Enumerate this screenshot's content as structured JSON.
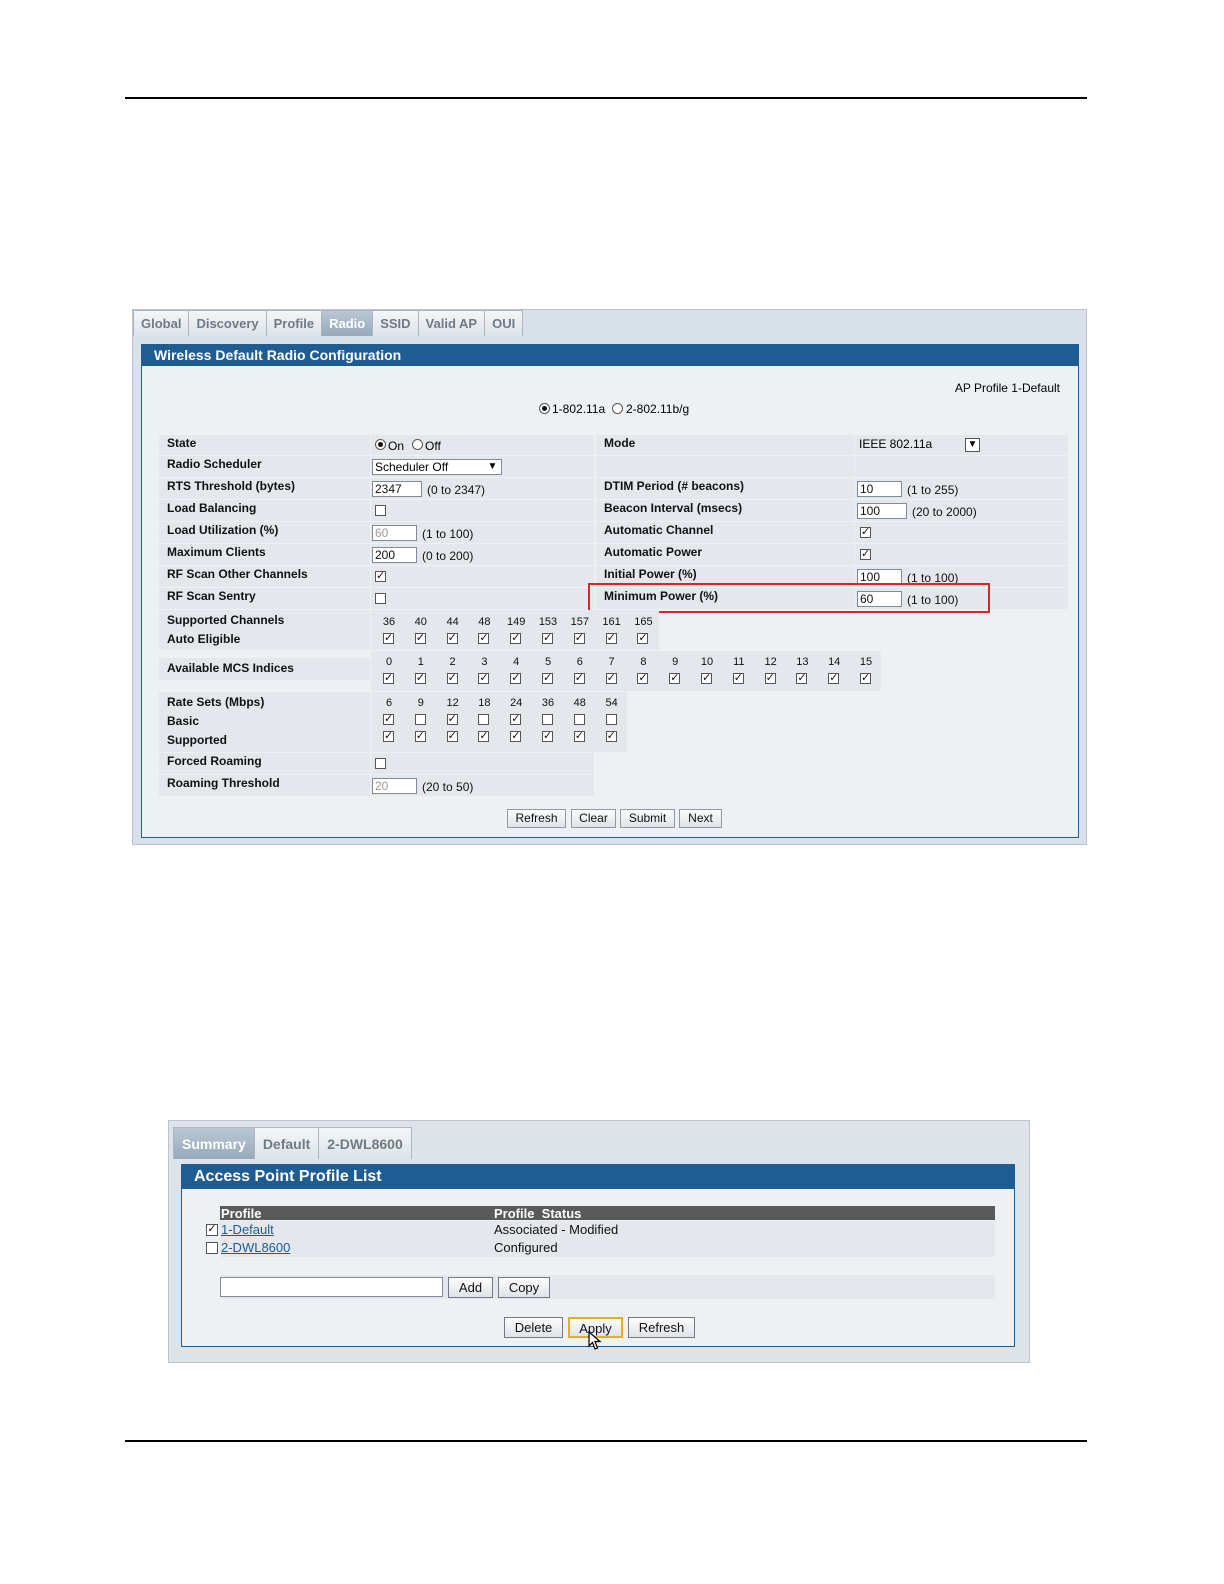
{
  "shot1": {
    "tabs": [
      "Global",
      "Discovery",
      "Profile",
      "Radio",
      "SSID",
      "Valid AP",
      "OUI"
    ],
    "active_tab": "Radio",
    "title": "Wireless Default Radio Configuration",
    "ap_profile": "AP Profile 1-Default",
    "radio_options": [
      "1-802.11a",
      "2-802.11b/g"
    ],
    "left": {
      "state_label": "State",
      "state_on": "On",
      "state_off": "Off",
      "scheduler_label": "Radio Scheduler",
      "scheduler_value": "Scheduler Off",
      "rts_label": "RTS Threshold (bytes)",
      "rts_value": "2347",
      "rts_hint": "(0 to 2347)",
      "lb_label": "Load Balancing",
      "lu_label": "Load Utilization (%)",
      "lu_value": "60",
      "lu_hint": "(1 to 100)",
      "mc_label": "Maximum Clients",
      "mc_value": "200",
      "mc_hint": "(0 to 200)",
      "rfo_label": "RF Scan Other Channels",
      "rfs_label": "RF Scan Sentry"
    },
    "right": {
      "mode_label": "Mode",
      "mode_value": "IEEE 802.11a",
      "dtim_label": "DTIM Period (# beacons)",
      "dtim_value": "10",
      "dtim_hint": "(1 to 255)",
      "beacon_label": "Beacon Interval (msecs)",
      "beacon_value": "100",
      "beacon_hint": "(20 to 2000)",
      "autoch_label": "Automatic Channel",
      "autopw_label": "Automatic Power",
      "initpw_label": "Initial Power (%)",
      "initpw_value": "100",
      "initpw_hint": "(1 to 100)",
      "minpw_label": "Minimum Power (%)",
      "minpw_value": "60",
      "minpw_hint": "(1 to 100)"
    },
    "channels": {
      "label1": "Supported Channels",
      "label2": "Auto Eligible",
      "values": [
        "36",
        "40",
        "44",
        "48",
        "149",
        "153",
        "157",
        "161",
        "165"
      ]
    },
    "mcs": {
      "label": "Available MCS Indices",
      "values": [
        "0",
        "1",
        "2",
        "3",
        "4",
        "5",
        "6",
        "7",
        "8",
        "9",
        "10",
        "11",
        "12",
        "13",
        "14",
        "15"
      ]
    },
    "rates": {
      "label1": "Rate Sets (Mbps)",
      "label2": "Basic",
      "label3": "Supported",
      "values": [
        "6",
        "9",
        "12",
        "18",
        "24",
        "36",
        "48",
        "54"
      ],
      "basic": [
        1,
        0,
        1,
        0,
        1,
        0,
        0,
        0
      ]
    },
    "roaming": {
      "forced_label": "Forced Roaming",
      "threshold_label": "Roaming Threshold",
      "threshold_value": "20",
      "threshold_hint": "(20 to 50)"
    },
    "buttons": {
      "refresh": "Refresh",
      "clear": "Clear",
      "submit": "Submit",
      "next": "Next"
    }
  },
  "shot2": {
    "tabs": [
      "Summary",
      "Default",
      "2-DWL8600"
    ],
    "active_tab": "Summary",
    "title": "Access Point Profile List",
    "col_profile": "Profile",
    "col_status": "Profile  Status",
    "rows": [
      {
        "name": "1-Default",
        "status": "Associated - Modified",
        "checked": true
      },
      {
        "name": "2-DWL8600",
        "status": "Configured",
        "checked": false
      }
    ],
    "buttons": {
      "add": "Add",
      "copy": "Copy",
      "delete": "Delete",
      "apply": "Apply",
      "refresh": "Refresh"
    }
  },
  "colors": {
    "header_blue": "#1f5c91",
    "highlight_red": "#d9252a",
    "link_blue": "#1a5c9a"
  }
}
